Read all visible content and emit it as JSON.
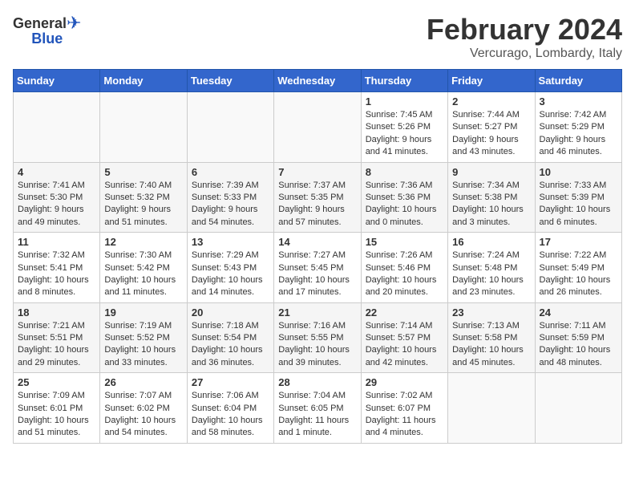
{
  "logo": {
    "general": "General",
    "blue": "Blue"
  },
  "header": {
    "title": "February 2024",
    "subtitle": "Vercurago, Lombardy, Italy"
  },
  "weekdays": [
    "Sunday",
    "Monday",
    "Tuesday",
    "Wednesday",
    "Thursday",
    "Friday",
    "Saturday"
  ],
  "weeks": [
    [
      {
        "day": "",
        "empty": true
      },
      {
        "day": "",
        "empty": true
      },
      {
        "day": "",
        "empty": true
      },
      {
        "day": "",
        "empty": true
      },
      {
        "day": "1",
        "sunrise": "Sunrise: 7:45 AM",
        "sunset": "Sunset: 5:26 PM",
        "daylight": "Daylight: 9 hours and 41 minutes."
      },
      {
        "day": "2",
        "sunrise": "Sunrise: 7:44 AM",
        "sunset": "Sunset: 5:27 PM",
        "daylight": "Daylight: 9 hours and 43 minutes."
      },
      {
        "day": "3",
        "sunrise": "Sunrise: 7:42 AM",
        "sunset": "Sunset: 5:29 PM",
        "daylight": "Daylight: 9 hours and 46 minutes."
      }
    ],
    [
      {
        "day": "4",
        "sunrise": "Sunrise: 7:41 AM",
        "sunset": "Sunset: 5:30 PM",
        "daylight": "Daylight: 9 hours and 49 minutes."
      },
      {
        "day": "5",
        "sunrise": "Sunrise: 7:40 AM",
        "sunset": "Sunset: 5:32 PM",
        "daylight": "Daylight: 9 hours and 51 minutes."
      },
      {
        "day": "6",
        "sunrise": "Sunrise: 7:39 AM",
        "sunset": "Sunset: 5:33 PM",
        "daylight": "Daylight: 9 hours and 54 minutes."
      },
      {
        "day": "7",
        "sunrise": "Sunrise: 7:37 AM",
        "sunset": "Sunset: 5:35 PM",
        "daylight": "Daylight: 9 hours and 57 minutes."
      },
      {
        "day": "8",
        "sunrise": "Sunrise: 7:36 AM",
        "sunset": "Sunset: 5:36 PM",
        "daylight": "Daylight: 10 hours and 0 minutes."
      },
      {
        "day": "9",
        "sunrise": "Sunrise: 7:34 AM",
        "sunset": "Sunset: 5:38 PM",
        "daylight": "Daylight: 10 hours and 3 minutes."
      },
      {
        "day": "10",
        "sunrise": "Sunrise: 7:33 AM",
        "sunset": "Sunset: 5:39 PM",
        "daylight": "Daylight: 10 hours and 6 minutes."
      }
    ],
    [
      {
        "day": "11",
        "sunrise": "Sunrise: 7:32 AM",
        "sunset": "Sunset: 5:41 PM",
        "daylight": "Daylight: 10 hours and 8 minutes."
      },
      {
        "day": "12",
        "sunrise": "Sunrise: 7:30 AM",
        "sunset": "Sunset: 5:42 PM",
        "daylight": "Daylight: 10 hours and 11 minutes."
      },
      {
        "day": "13",
        "sunrise": "Sunrise: 7:29 AM",
        "sunset": "Sunset: 5:43 PM",
        "daylight": "Daylight: 10 hours and 14 minutes."
      },
      {
        "day": "14",
        "sunrise": "Sunrise: 7:27 AM",
        "sunset": "Sunset: 5:45 PM",
        "daylight": "Daylight: 10 hours and 17 minutes."
      },
      {
        "day": "15",
        "sunrise": "Sunrise: 7:26 AM",
        "sunset": "Sunset: 5:46 PM",
        "daylight": "Daylight: 10 hours and 20 minutes."
      },
      {
        "day": "16",
        "sunrise": "Sunrise: 7:24 AM",
        "sunset": "Sunset: 5:48 PM",
        "daylight": "Daylight: 10 hours and 23 minutes."
      },
      {
        "day": "17",
        "sunrise": "Sunrise: 7:22 AM",
        "sunset": "Sunset: 5:49 PM",
        "daylight": "Daylight: 10 hours and 26 minutes."
      }
    ],
    [
      {
        "day": "18",
        "sunrise": "Sunrise: 7:21 AM",
        "sunset": "Sunset: 5:51 PM",
        "daylight": "Daylight: 10 hours and 29 minutes."
      },
      {
        "day": "19",
        "sunrise": "Sunrise: 7:19 AM",
        "sunset": "Sunset: 5:52 PM",
        "daylight": "Daylight: 10 hours and 33 minutes."
      },
      {
        "day": "20",
        "sunrise": "Sunrise: 7:18 AM",
        "sunset": "Sunset: 5:54 PM",
        "daylight": "Daylight: 10 hours and 36 minutes."
      },
      {
        "day": "21",
        "sunrise": "Sunrise: 7:16 AM",
        "sunset": "Sunset: 5:55 PM",
        "daylight": "Daylight: 10 hours and 39 minutes."
      },
      {
        "day": "22",
        "sunrise": "Sunrise: 7:14 AM",
        "sunset": "Sunset: 5:57 PM",
        "daylight": "Daylight: 10 hours and 42 minutes."
      },
      {
        "day": "23",
        "sunrise": "Sunrise: 7:13 AM",
        "sunset": "Sunset: 5:58 PM",
        "daylight": "Daylight: 10 hours and 45 minutes."
      },
      {
        "day": "24",
        "sunrise": "Sunrise: 7:11 AM",
        "sunset": "Sunset: 5:59 PM",
        "daylight": "Daylight: 10 hours and 48 minutes."
      }
    ],
    [
      {
        "day": "25",
        "sunrise": "Sunrise: 7:09 AM",
        "sunset": "Sunset: 6:01 PM",
        "daylight": "Daylight: 10 hours and 51 minutes."
      },
      {
        "day": "26",
        "sunrise": "Sunrise: 7:07 AM",
        "sunset": "Sunset: 6:02 PM",
        "daylight": "Daylight: 10 hours and 54 minutes."
      },
      {
        "day": "27",
        "sunrise": "Sunrise: 7:06 AM",
        "sunset": "Sunset: 6:04 PM",
        "daylight": "Daylight: 10 hours and 58 minutes."
      },
      {
        "day": "28",
        "sunrise": "Sunrise: 7:04 AM",
        "sunset": "Sunset: 6:05 PM",
        "daylight": "Daylight: 11 hours and 1 minute."
      },
      {
        "day": "29",
        "sunrise": "Sunrise: 7:02 AM",
        "sunset": "Sunset: 6:07 PM",
        "daylight": "Daylight: 11 hours and 4 minutes."
      },
      {
        "day": "",
        "empty": true
      },
      {
        "day": "",
        "empty": true
      }
    ]
  ]
}
